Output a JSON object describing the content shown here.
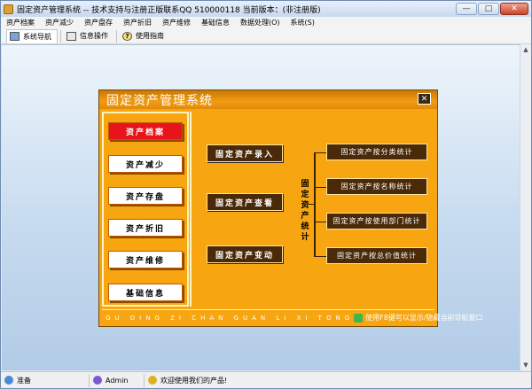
{
  "window": {
    "title": "固定资产管理系统 -- 技术支持与注册正版联系QQ 510000118     当前版本：(非注册版)",
    "minimize": "—",
    "maximize": "□",
    "close": "✕"
  },
  "menu": [
    "资产档案",
    "资产减少",
    "资产盘存",
    "资产折旧",
    "资产维修",
    "基础信息",
    "数据处理(O)",
    "系统(S)"
  ],
  "toolbar": [
    {
      "label": "系统导航",
      "icon": "nav-icon"
    },
    {
      "label": "信息操作",
      "icon": "info-icon"
    },
    {
      "label": "使用指南",
      "icon": "help-icon"
    }
  ],
  "dialog": {
    "title": "固定资产管理系统",
    "close": "✕",
    "left_buttons": [
      "资产档案",
      "资产减少",
      "资产存盘",
      "资产折旧",
      "资产维修",
      "基础信息"
    ],
    "main_buttons": [
      "固定资产录入",
      "固定资产查看",
      "固定资产变动"
    ],
    "stat_label": "固定资产统计",
    "stat_buttons": [
      "固定资产按分类统计",
      "固定资产按名称统计",
      "固定资产按使用部门统计",
      "固定资产按总价值统计"
    ],
    "pinyin": "GU DING ZI CHAN GUAN LI XI TONG",
    "hint": "使用F8键可以显示/隐藏当前导航窗口"
  },
  "status": {
    "state": "准备",
    "user": "Admin",
    "welcome": "欢迎使用我们的产品!"
  },
  "colors": {
    "dialog_bg": "#f7a510",
    "active_button": "#e8141a",
    "dark_button": "#4a2a08"
  }
}
